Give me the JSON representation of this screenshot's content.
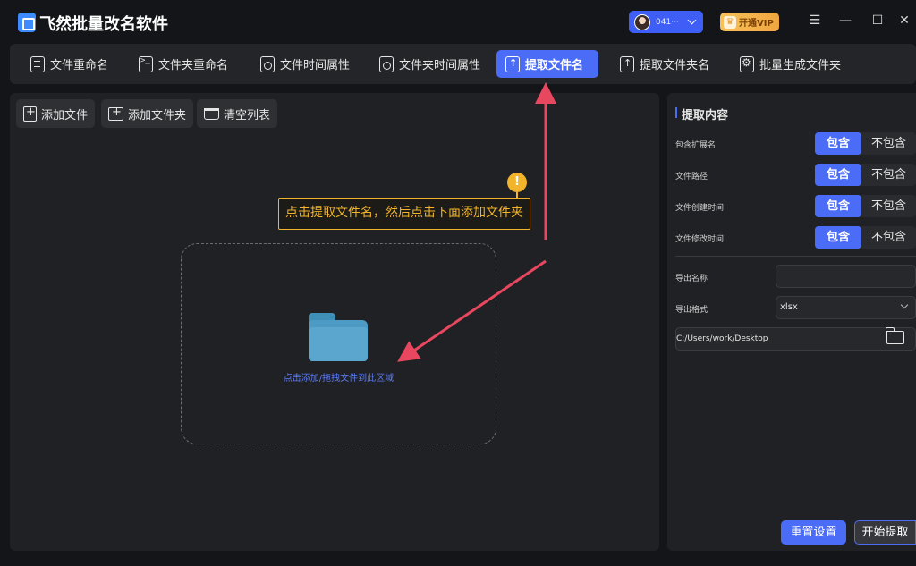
{
  "app": {
    "title": "飞然批量改名软件",
    "user_name": "041···",
    "vip_label": "开通VIP",
    "window_controls": [
      "menu-icon",
      "minimize-icon",
      "maximize-icon",
      "close-icon"
    ]
  },
  "tabs": [
    {
      "label": "文件重命名",
      "icon": "file-icon"
    },
    {
      "label": "文件夹重命名",
      "icon": "terminal-folder-icon"
    },
    {
      "label": "文件时间属性",
      "icon": "clock-file-icon"
    },
    {
      "label": "文件夹时间属性",
      "icon": "clock-folder-icon"
    },
    {
      "label": "提取文件名",
      "icon": "extract-file-icon",
      "active": true
    },
    {
      "label": "提取文件夹名",
      "icon": "upload-folder-icon"
    },
    {
      "label": "批量生成文件夹",
      "icon": "gear-folder-icon"
    }
  ],
  "toolbar": {
    "add_file": "添加文件",
    "add_folder": "添加文件夹",
    "clear_list": "清空列表"
  },
  "tooltip": {
    "badge": "!",
    "text": "点击提取文件名，然后点击下面添加文件夹"
  },
  "drop_zone": {
    "hint": "点击添加/拖拽文件到此区域"
  },
  "right_panel": {
    "title": "提取内容",
    "options": [
      {
        "label": "包含扩展名",
        "include": "包含",
        "exclude": "不包含",
        "selected": "include"
      },
      {
        "label": "文件路径",
        "include": "包含",
        "exclude": "不包含",
        "selected": "include"
      },
      {
        "label": "文件创建时间",
        "include": "包含",
        "exclude": "不包含",
        "selected": "include"
      },
      {
        "label": "文件修改时间",
        "include": "包含",
        "exclude": "不包含",
        "selected": "include"
      }
    ],
    "export_name_label": "导出名称",
    "export_name_value": "",
    "export_format_label": "导出格式",
    "export_format_value": "xlsx",
    "export_path": "C:/Users/work/Desktop",
    "reset_button": "重置设置",
    "start_button": "开始提取"
  },
  "colors": {
    "accent": "#4b6cf7",
    "tooltip": "#f2b42b",
    "annotation_arrow": "#e8475f",
    "background": "#141518",
    "panel": "#202124"
  }
}
